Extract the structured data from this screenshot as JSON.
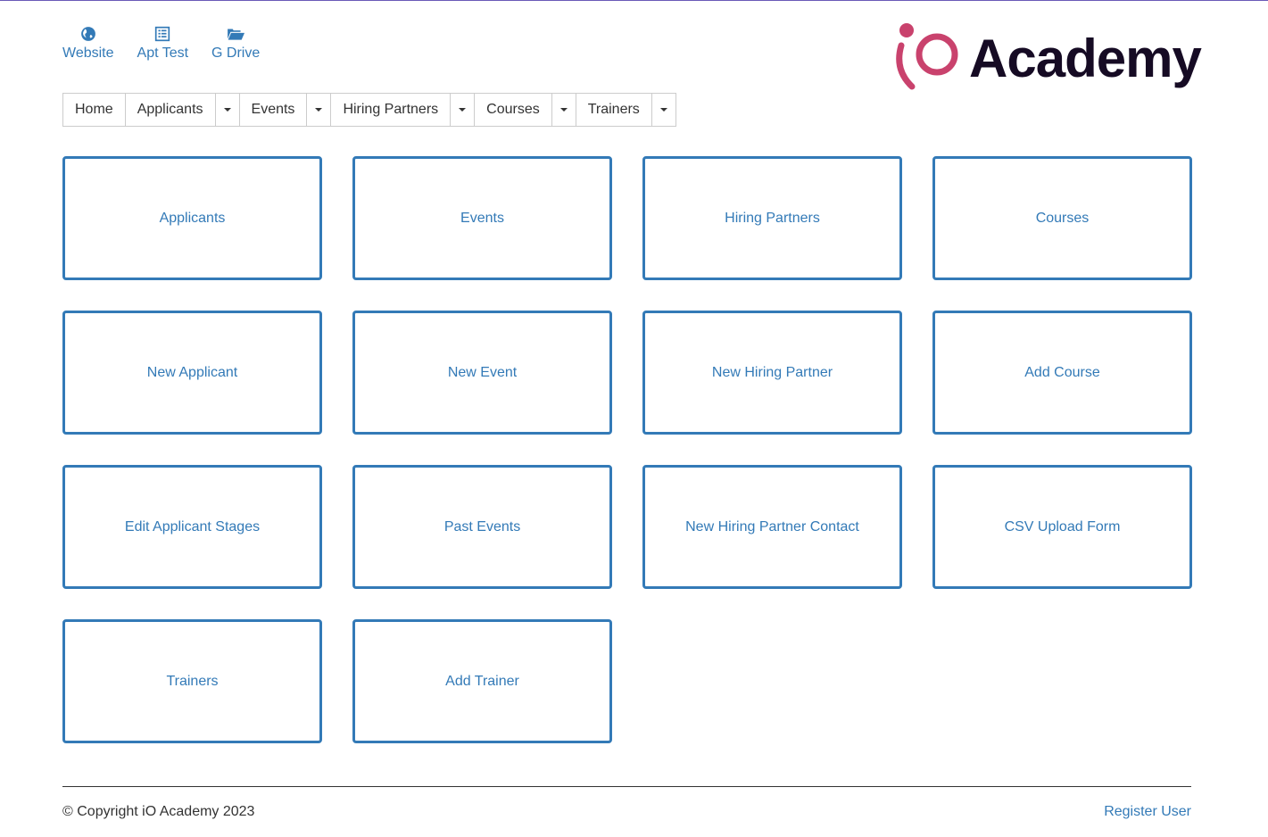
{
  "quick_links": [
    {
      "label": "Website",
      "icon": "globe-icon"
    },
    {
      "label": "Apt Test",
      "icon": "list-alt-icon"
    },
    {
      "label": "G Drive",
      "icon": "folder-open-icon"
    }
  ],
  "brand": {
    "name": "Academy",
    "mark": "iO",
    "mark_color": "#c9426d",
    "text_color": "#160b24"
  },
  "navbar": {
    "home": "Home",
    "items": [
      {
        "label": "Applicants",
        "has_dropdown": true
      },
      {
        "label": "Events",
        "has_dropdown": true
      },
      {
        "label": "Hiring Partners",
        "has_dropdown": true
      },
      {
        "label": "Courses",
        "has_dropdown": true
      },
      {
        "label": "Trainers",
        "has_dropdown": true
      }
    ]
  },
  "tiles": [
    "Applicants",
    "Events",
    "Hiring Partners",
    "Courses",
    "New Applicant",
    "New Event",
    "New Hiring Partner",
    "Add Course",
    "Edit Applicant Stages",
    "Past Events",
    "New Hiring Partner Contact",
    "CSV Upload Form",
    "Trainers",
    "Add Trainer"
  ],
  "footer": {
    "copyright": "© Copyright iO Academy 2023",
    "register_link": "Register User"
  },
  "colors": {
    "accent": "#337ab7",
    "top_border": "#6a5ab8"
  }
}
